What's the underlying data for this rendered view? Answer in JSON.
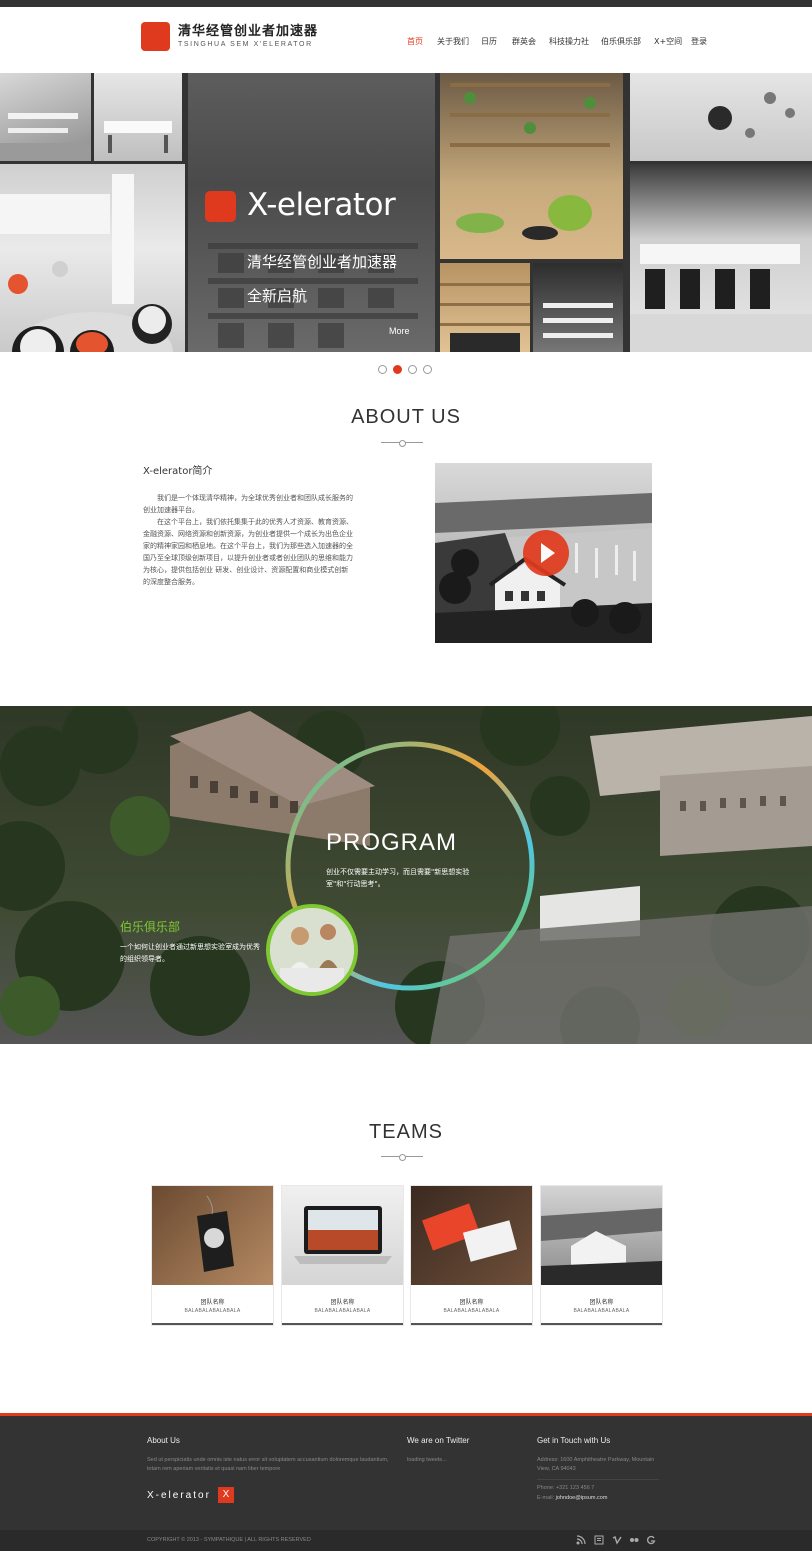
{
  "brand": {
    "name_cn": "清华经管创业者加速器",
    "name_en": "TSINGHUA SEM X'ELERATOR",
    "accent": "#e03a1e"
  },
  "nav": {
    "items": [
      "首页",
      "关于我们",
      "日历",
      "群英会",
      "科技操力社",
      "伯乐俱乐部",
      "X+空间",
      "登录"
    ],
    "active_index": 0
  },
  "hero": {
    "title": "X-elerator",
    "subtitle1": "清华经管创业者加速器",
    "subtitle2": "全新启航",
    "more": "More",
    "slides": 4,
    "active_slide": 1
  },
  "about": {
    "section_title": "ABOUT US",
    "heading": "X-elerator简介",
    "paragraph1": "我们是一个体现清华精神，为全球优秀创业者和团队成长服务的创业加速器平台。",
    "paragraph2": "在这个平台上，我们依托集集于此的优秀人才资源、教育资源、金融资源、网络资源和创新资源，为创业者提供一个成长为出色企业家的精神家园和栖息地。在这个平台上，我们为那些选入加速器的全国乃至全球顶级创新项目，以提升创业者或者创业团队的思维和能力为核心，提供包括创业 研发、创业设计、资源配置和商业模式创新的深度整合服务。"
  },
  "program": {
    "title": "PROGRAM",
    "text": "创业不仅需要主动学习，而且需要\"新思想实验室\"和\"行动思考\"。",
    "club_title": "伯乐俱乐部",
    "club_text": "一个如何让创业者通过新思想实验室成为优秀的组织领导者。"
  },
  "teams": {
    "section_title": "TEAMS",
    "cards": [
      {
        "name": "团队名称",
        "sub": "BALABALABALABALA"
      },
      {
        "name": "团队名称",
        "sub": "BALABALABALABALA"
      },
      {
        "name": "团队名称",
        "sub": "BALABALABALABALA"
      },
      {
        "name": "团队名称",
        "sub": "BALABALABALABALA"
      }
    ]
  },
  "footer": {
    "about_title": "About Us",
    "about_text": "Sed ut perspiciatis unde omnis iste natus error sit voluptatem accusantium doloremque laudantium, totam rem aperiam veritatis et quasi nam liber tempore",
    "logo_text": "X-elerator",
    "logo_mark": "X",
    "twitter_title": "We are on Twitter",
    "twitter_text": "loading tweets...",
    "contact_title": "Get in Touch with Us",
    "address": "Address: 1600 Amphitheatre Parkway, Mountain View, CA 94043",
    "phone": "Phone: +321 123 456 7",
    "email_label": "E-mail:",
    "email": "johndoe@ipsum.com",
    "copyright": "COPYRIGHT © 2013 - SYMPATHIQUE | ALL RIGHTS RESERVED",
    "social_icons": [
      "rss-icon",
      "blog-icon",
      "vimeo-icon",
      "flickr-icon",
      "google-icon"
    ]
  }
}
